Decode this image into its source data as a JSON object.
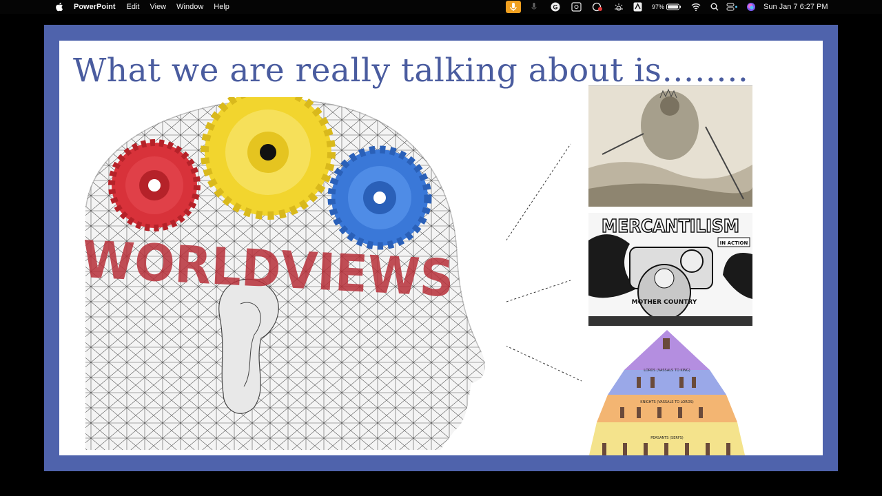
{
  "menubar": {
    "app_name": "PowerPoint",
    "menus": [
      "Edit",
      "View",
      "Window",
      "Help"
    ],
    "battery_percent": "97%",
    "clock": "Sun Jan 7  6:27 PM",
    "status_icons": [
      "microphone-active-icon",
      "microphone-icon",
      "grammarly-icon",
      "screen-share-icon",
      "recording-icon",
      "brightness-icon",
      "text-icon",
      "battery-icon",
      "wifi-icon",
      "search-icon",
      "control-center-icon",
      "siri-icon"
    ]
  },
  "slide": {
    "title": "What we are really talking about is……..",
    "head_label": "WORLDVIEWS",
    "cartoon_title": "MERCANTILISM",
    "cartoon_badge": "IN ACTION",
    "cartoon_caption": "MOTHER COUNTRY",
    "pyramid": {
      "tier2": "LORDS (VASSALS TO KING)",
      "tier3": "KNIGHTS (VASSALS TO LORDS)",
      "tier4": "PEASANTS (SERFS)"
    },
    "colors": {
      "frame": "#4f63ac",
      "title": "#4a5c9f",
      "gear_red": "#d8323a",
      "gear_yellow": "#f2d52e",
      "gear_blue": "#3a78d8"
    }
  }
}
